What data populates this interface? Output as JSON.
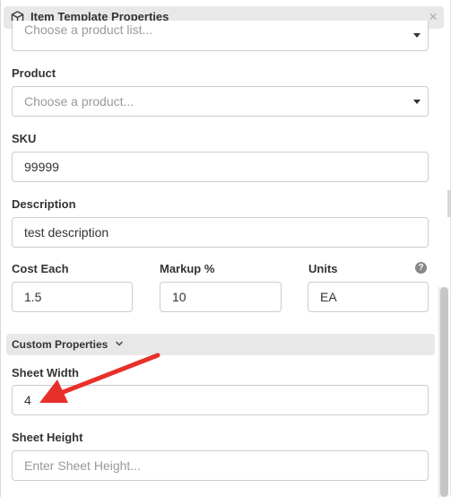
{
  "dialog": {
    "title": "Item Template Properties",
    "close_glyph": "×",
    "icons": {
      "header": "cube-icon",
      "close": "close-icon"
    }
  },
  "form": {
    "product_list": {
      "placeholder": "Choose a product list..."
    },
    "product": {
      "label": "Product",
      "placeholder": "Choose a product..."
    },
    "sku": {
      "label": "SKU",
      "value": "99999"
    },
    "description": {
      "label": "Description",
      "value": "test description"
    },
    "cost_each": {
      "label": "Cost Each",
      "value": "1.5"
    },
    "markup": {
      "label": "Markup %",
      "value": "10"
    },
    "units": {
      "label": "Units",
      "value": "EA",
      "help_glyph": "?"
    }
  },
  "custom_properties": {
    "title": "Custom Properties",
    "sheet_width": {
      "label": "Sheet Width",
      "value": "4"
    },
    "sheet_height": {
      "label": "Sheet Height",
      "placeholder": "Enter Sheet Height..."
    }
  },
  "annotation": {
    "color": "#e8302a"
  }
}
